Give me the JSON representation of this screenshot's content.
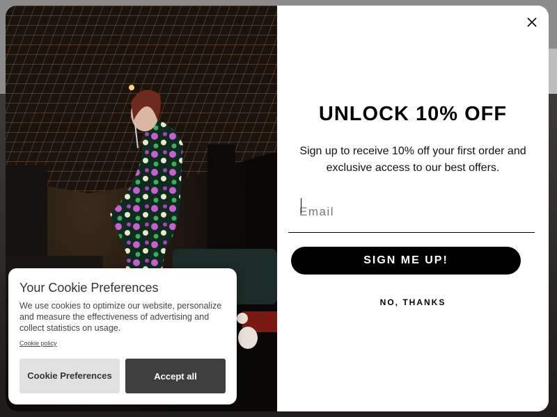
{
  "popup": {
    "headline": "UNLOCK 10% OFF",
    "subtext": "Sign up to receive 10% off your first order and exclusive access to our best offers.",
    "email_placeholder": "Email",
    "email_value": "",
    "signup_label": "SIGN ME UP!",
    "decline_label": "NO, THANKS",
    "close_icon": "close-icon",
    "image_subject": "model-in-floral-jumpsuit"
  },
  "cookie": {
    "title": "Your Cookie Preferences",
    "body": "We use cookies to optimize our website, personalize and measure the effectiveness of advertising and collect statistics on usage.",
    "policy_link": "Cookie policy",
    "preferences_label": "Cookie Preferences",
    "accept_label": "Accept all"
  },
  "colors": {
    "primary_button": "#000000",
    "accept_button": "#3f3f3f",
    "preferences_button": "#e1e1e1"
  }
}
